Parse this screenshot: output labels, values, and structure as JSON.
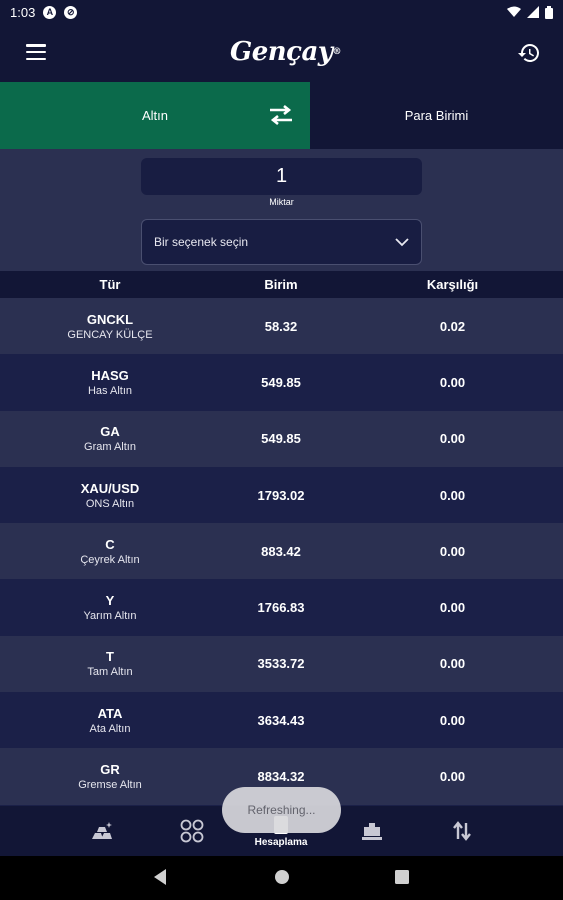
{
  "status": {
    "time": "1:03",
    "notif_icons": [
      "android-auto-icon",
      "search-circle-icon"
    ],
    "right_icons": [
      "wifi-icon",
      "signal-icon",
      "battery-icon"
    ]
  },
  "app_bar": {
    "logo_text": "Gençay",
    "logo_mark": "®",
    "menu_icon": "menu-icon",
    "history_icon": "history-icon"
  },
  "tabs": {
    "active_label": "Altın",
    "inactive_label": "Para Birimi",
    "swap_icon": "swap-arrows-icon"
  },
  "form": {
    "quantity_value": "1",
    "quantity_label": "Miktar",
    "select_placeholder": "Bir seçenek seçin"
  },
  "table": {
    "headers": [
      "Tür",
      "Birim",
      "Karşılığı"
    ],
    "rows": [
      {
        "code": "GNCKL",
        "name": "GENCAY KÜLÇE",
        "unit": "58.32",
        "value": "0.02"
      },
      {
        "code": "HASG",
        "name": "Has Altın",
        "unit": "549.85",
        "value": "0.00"
      },
      {
        "code": "GA",
        "name": "Gram Altın",
        "unit": "549.85",
        "value": "0.00"
      },
      {
        "code": "XAU/USD",
        "name": "ONS Altın",
        "unit": "1793.02",
        "value": "0.00"
      },
      {
        "code": "C",
        "name": "Çeyrek Altın",
        "unit": "883.42",
        "value": "0.00"
      },
      {
        "code": "Y",
        "name": "Yarım Altın",
        "unit": "1766.83",
        "value": "0.00"
      },
      {
        "code": "T",
        "name": "Tam Altın",
        "unit": "3533.72",
        "value": "0.00"
      },
      {
        "code": "ATA",
        "name": "Ata Altın",
        "unit": "3634.43",
        "value": "0.00"
      },
      {
        "code": "GR",
        "name": "Gremse Altın",
        "unit": "8834.32",
        "value": "0.00"
      }
    ]
  },
  "toast": "Refreshing...",
  "bottom_nav": {
    "items": [
      {
        "icon": "gold-bars-icon"
      },
      {
        "icon": "currency-grid-icon"
      },
      {
        "icon": "calculator-icon",
        "label": "Hesaplama"
      },
      {
        "icon": "bank-icon"
      },
      {
        "icon": "exchange-arrows-icon"
      }
    ]
  },
  "colors": {
    "background": "#1b2048",
    "bar": "#121636",
    "accent_green": "#0b6a4b",
    "row_alt": "#2b3051"
  }
}
